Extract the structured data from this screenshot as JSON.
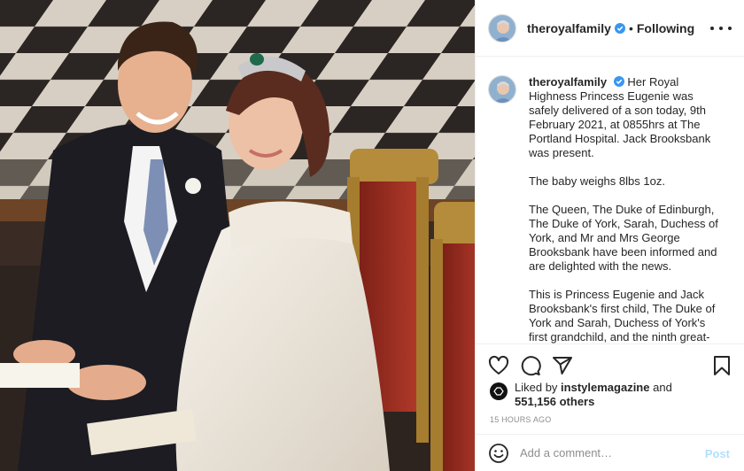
{
  "post": {
    "username": "theroyalfamily",
    "dot": "•",
    "follow_label": "Following",
    "caption_user": "theroyalfamily",
    "caption_paragraphs": [
      "Her Royal Highness Princess Eugenie was safely delivered of a son today, 9th February 2021, at 0855hrs at The Portland Hospital. Jack Brooksbank was present.",
      "The baby weighs 8lbs 1oz.",
      "The Queen, The Duke of Edinburgh, The Duke of York, Sarah, Duchess of York, and Mr and Mrs George Brooksbank have been informed and are delighted with the news.",
      "This is Princess Eugenie and Jack Brooksbank's first child, The Duke of York and Sarah, Duchess of York's first grandchild, and the ninth great-grandchild for The Queen and The"
    ]
  },
  "likes": {
    "prefix": "Liked by",
    "user": "instylemagazine",
    "and": "and",
    "count": "551,156 others"
  },
  "timestamp": "15 HOURS AGO",
  "comment": {
    "placeholder": "Add a comment…",
    "post_label": "Post"
  },
  "icons": [
    "heart-icon",
    "comment-icon",
    "share-icon",
    "bookmark-icon",
    "emoji-icon",
    "verified-badge-icon",
    "more-options-icon"
  ],
  "colors": {
    "verified": "#3897f0",
    "post_disabled": "#b2dffc",
    "muted": "#8e8e8e",
    "border": "#efefef"
  }
}
